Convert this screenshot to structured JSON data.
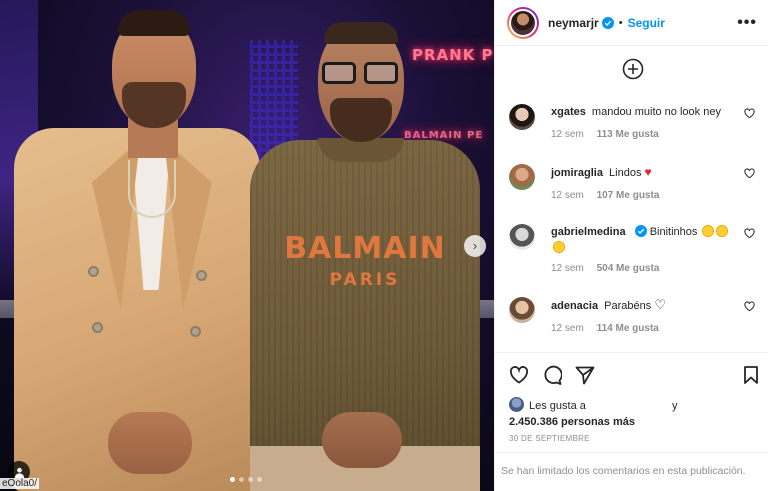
{
  "post": {
    "watermark": "eOola0/",
    "carousel": {
      "total_slides": 4,
      "active_slide": 1
    },
    "neon_sign_1": "PRANK P",
    "neon_sign_2": "BALMAIN PE",
    "sweater_logo": {
      "line1": "BALMAIN",
      "line2": "PARIS"
    },
    "colors": {
      "logo": "#e0773f",
      "suit": "#d6a774",
      "sweater": "#6d5a38"
    }
  },
  "header": {
    "username": "neymarjr",
    "separator": "•",
    "follow_label": "Seguir",
    "more_icon": "more-horizontal-icon",
    "verified_icon": "verified-badge-icon"
  },
  "comments": [
    {
      "user": "xgates",
      "text": "mandou muito no look ney",
      "time": "12 sem",
      "likes": "113 Me gusta"
    },
    {
      "user": "jomiraglia",
      "text": "Lindos",
      "time": "12 sem",
      "likes": "107 Me gusta",
      "emoji": "red-heart"
    },
    {
      "user": "gabrielmedina",
      "text": "Binitinhos",
      "time": "12 sem",
      "likes": "504 Me gusta",
      "verified": true,
      "emoji": "crazy-face"
    },
    {
      "user": "adenacia",
      "text": "Parabéns",
      "time": "12 sem",
      "likes": "114 Me gusta",
      "emoji": "white-heart"
    }
  ],
  "actions": {
    "like_icon": "heart-icon",
    "comment_icon": "comment-icon",
    "share_icon": "share-icon",
    "save_icon": "bookmark-icon"
  },
  "likes": {
    "prefix": "Les gusta a",
    "connector": "y",
    "count": "2.450.386 personas más"
  },
  "date": "30 DE SEPTIEMBRE",
  "comments_limited": "Se han limitado los comentarios en esta publicación.",
  "brand_colors": {
    "link": "#0095f6",
    "muted": "#8e8e8e",
    "heart": "#ed1b3b"
  }
}
